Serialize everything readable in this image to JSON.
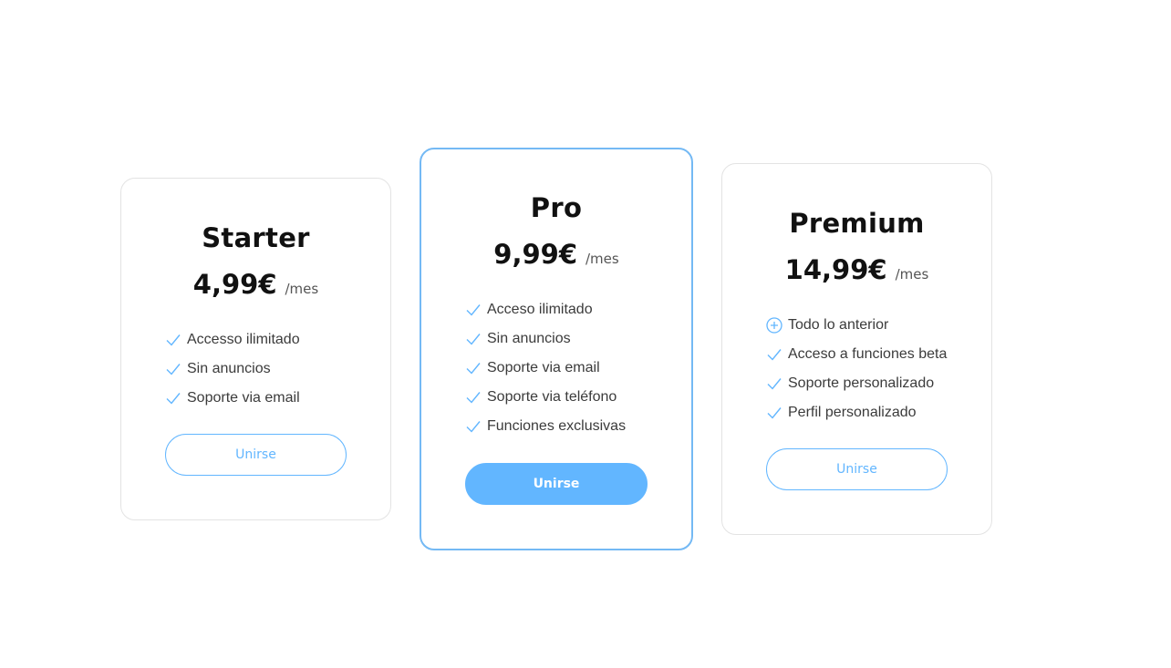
{
  "accent_color": "#62b6ff",
  "plans": [
    {
      "name": "Starter",
      "price": "4,99€",
      "period": "/mes",
      "features": [
        {
          "icon": "check-icon",
          "label": "Accesso ilimitado"
        },
        {
          "icon": "check-icon",
          "label": "Sin anuncios"
        },
        {
          "icon": "check-icon",
          "label": "Soporte via email"
        }
      ],
      "button_label": "Unirse",
      "featured": false
    },
    {
      "name": "Pro",
      "price": "9,99€",
      "period": "/mes",
      "features": [
        {
          "icon": "check-icon",
          "label": "Acceso ilimitado"
        },
        {
          "icon": "check-icon",
          "label": "Sin anuncios"
        },
        {
          "icon": "check-icon",
          "label": "Soporte via email"
        },
        {
          "icon": "check-icon",
          "label": "Soporte via teléfono"
        },
        {
          "icon": "check-icon",
          "label": "Funciones exclusivas"
        }
      ],
      "button_label": "Unirse",
      "featured": true
    },
    {
      "name": "Premium",
      "price": "14,99€",
      "period": "/mes",
      "features": [
        {
          "icon": "plus-circle-icon",
          "label": "Todo lo anterior"
        },
        {
          "icon": "check-icon",
          "label": "Acceso a funciones beta"
        },
        {
          "icon": "check-icon",
          "label": "Soporte personalizado"
        },
        {
          "icon": "check-icon",
          "label": "Perfil personalizado"
        }
      ],
      "button_label": "Unirse",
      "featured": false
    }
  ]
}
